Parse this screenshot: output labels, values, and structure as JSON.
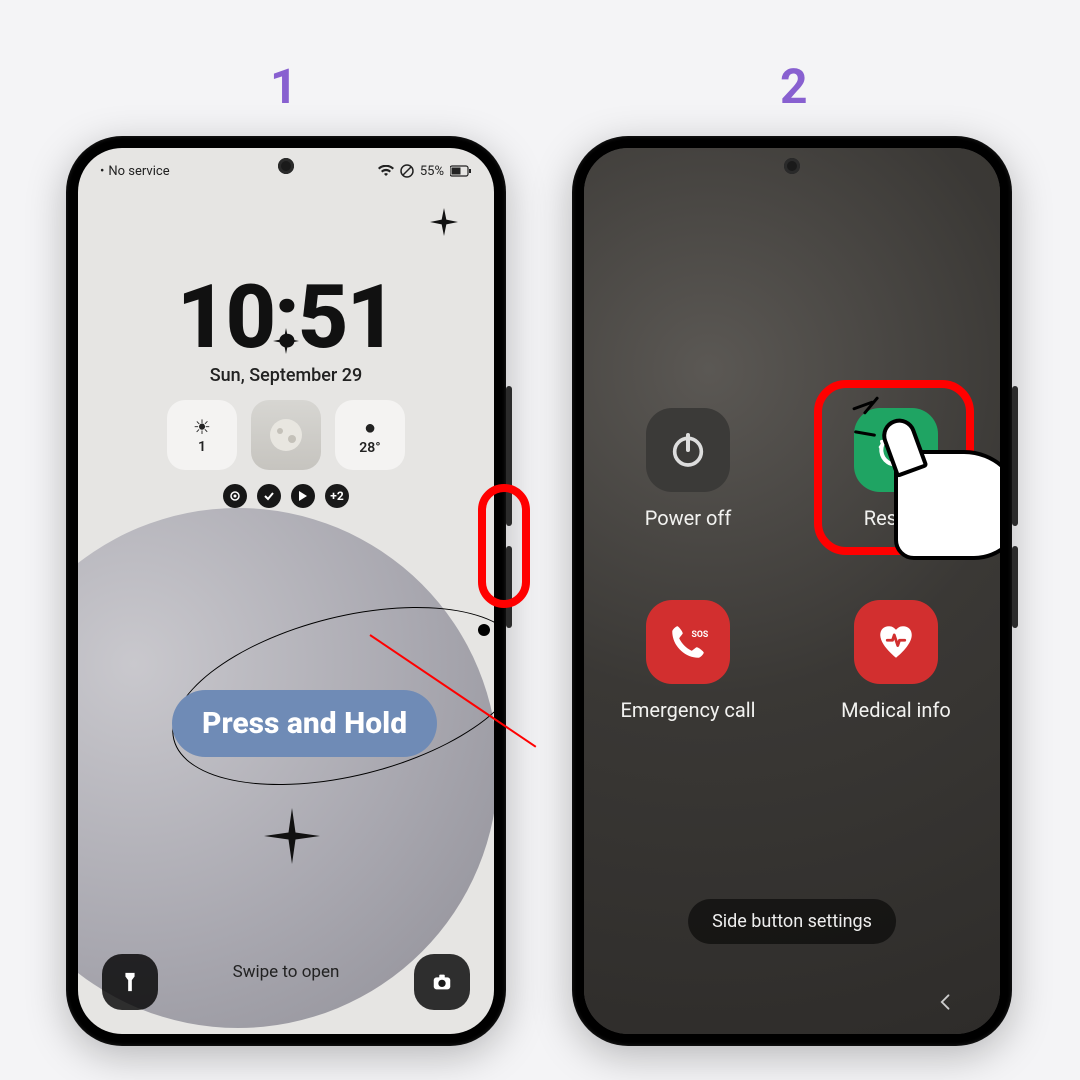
{
  "steps": {
    "one": "1",
    "two": "2"
  },
  "annotation": {
    "press_hold": "Press and Hold"
  },
  "phone1": {
    "status": {
      "carrier": "No service",
      "battery": "55%"
    },
    "clock": "10:51",
    "date": "Sun, September 29",
    "widgets": {
      "first_value": "1",
      "temp": "28°"
    },
    "badges": {
      "plus": "+2"
    },
    "swipe": "Swipe to open"
  },
  "phone2": {
    "power": {
      "power_off": "Power off",
      "restart": "Restart",
      "emergency": "Emergency call",
      "medical": "Medical info",
      "sos": "SOS"
    },
    "side_settings": "Side button settings"
  }
}
